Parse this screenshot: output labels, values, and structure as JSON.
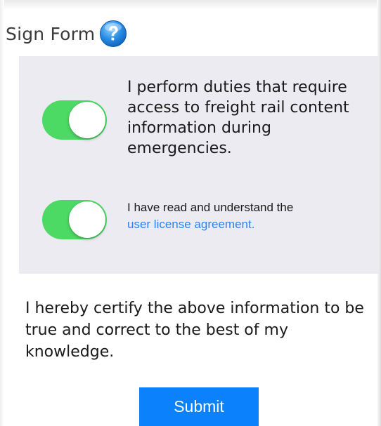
{
  "header": {
    "title": "Sign Form",
    "help_icon": "help-icon"
  },
  "toggles": [
    {
      "label": "I perform duties that require access to freight rail content information during emergencies.",
      "on": true
    },
    {
      "label_prefix": "I have read and understand the",
      "link_text": "user license agreement.",
      "on": true
    }
  ],
  "certification": "I hereby certify the above information to be true and correct to the best of my knowledge.",
  "submit_label": "Submit",
  "colors": {
    "toggle_on": "#4cd964",
    "panel_background": "#ecebf2",
    "link": "#2b82f0",
    "submit_button": "#0b82fb"
  }
}
